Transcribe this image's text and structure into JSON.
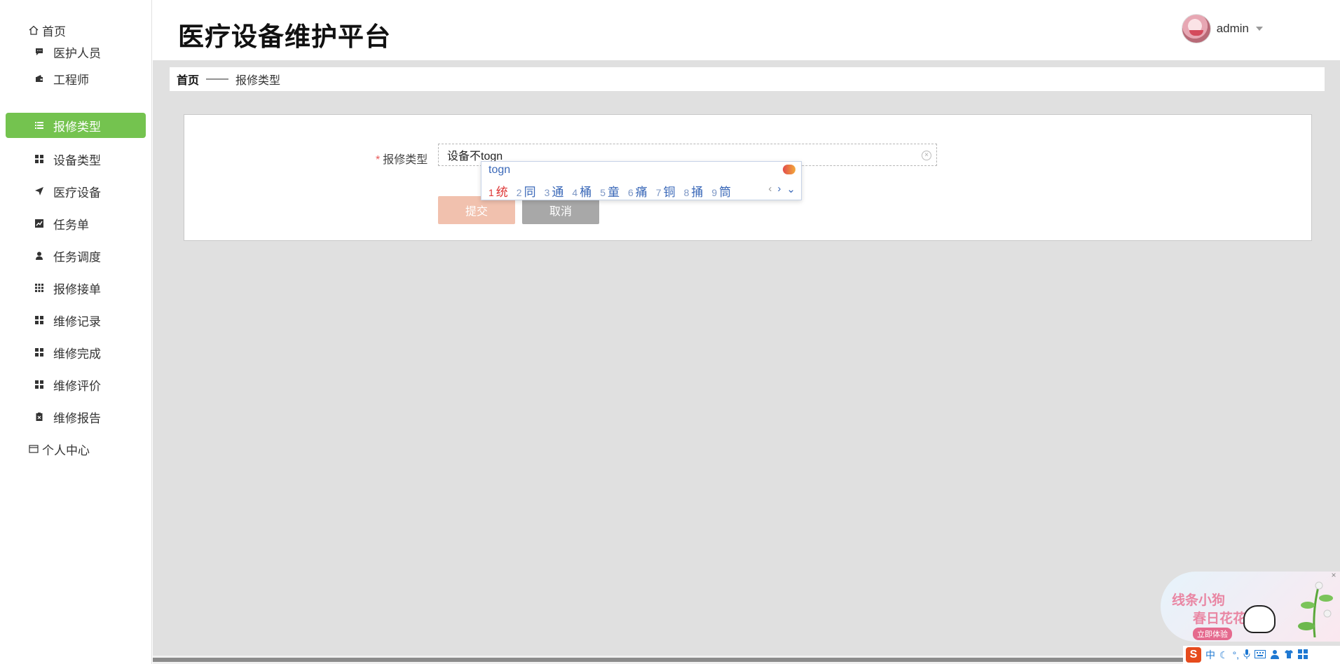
{
  "header": {
    "title": "医疗设备维护平台",
    "username": "admin"
  },
  "sidebar": {
    "items": [
      {
        "label": "首页",
        "icon": "home-icon"
      },
      {
        "label": "医护人员",
        "icon": "comment-icon"
      },
      {
        "label": "工程师",
        "icon": "wallet-icon"
      },
      {
        "label": "报修类型",
        "icon": "list-icon",
        "active": true
      },
      {
        "label": "设备类型",
        "icon": "grid-icon"
      },
      {
        "label": "医疗设备",
        "icon": "send-icon"
      },
      {
        "label": "任务单",
        "icon": "chart-icon"
      },
      {
        "label": "任务调度",
        "icon": "user-icon"
      },
      {
        "label": "报修接单",
        "icon": "apps-icon"
      },
      {
        "label": "维修记录",
        "icon": "grid-icon"
      },
      {
        "label": "维修完成",
        "icon": "grid-icon"
      },
      {
        "label": "维修评价",
        "icon": "grid-icon"
      },
      {
        "label": "维修报告",
        "icon": "clipboard-icon"
      },
      {
        "label": "个人中心",
        "icon": "card-icon"
      }
    ],
    "active_color": "#74c34f"
  },
  "breadcrumb": {
    "home": "首页",
    "separator": "——",
    "current": "报修类型"
  },
  "form": {
    "field_label": "报修类型",
    "required_mark": "*",
    "input_value": "设备不togn",
    "submit_label": "提交",
    "cancel_label": "取消"
  },
  "ime_popup": {
    "composition": "togn",
    "candidates": [
      {
        "num": "1",
        "text": "统"
      },
      {
        "num": "2",
        "text": "同"
      },
      {
        "num": "3",
        "text": "通"
      },
      {
        "num": "4",
        "text": "桶"
      },
      {
        "num": "5",
        "text": "童"
      },
      {
        "num": "6",
        "text": "痛"
      },
      {
        "num": "7",
        "text": "铜"
      },
      {
        "num": "8",
        "text": "捅"
      },
      {
        "num": "9",
        "text": "筒"
      }
    ],
    "prev": "‹",
    "next": "›",
    "expand": "⌄"
  },
  "ad": {
    "line1": "线条小狗",
    "line2": "春日花花",
    "button": "立即体验",
    "close": "×"
  },
  "ime_bar": {
    "logo": "S",
    "mode": "中",
    "icons": [
      "moon-icon",
      "punct-icon",
      "mic-icon",
      "keyboard-icon",
      "user-icon",
      "shirt-icon",
      "grid-icon"
    ]
  },
  "colors": {
    "accent": "#74c34f",
    "submit": "#f1c1ae",
    "cancel": "#a8a8a8",
    "main_bg": "#e0e0e0"
  }
}
